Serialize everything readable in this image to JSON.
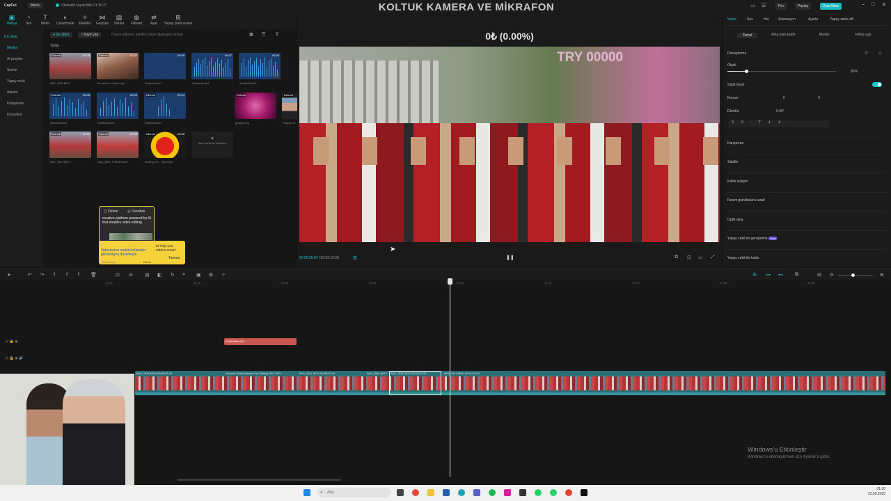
{
  "topbar": {
    "menu": "Menü",
    "autosave": "Otomatik kaydedildi: 01:50:27",
    "overlay_title": "KOLTUK KAMERA VE MİKRAFON",
    "pro": "Pro",
    "paylas": "Paylaş",
    "export": "Dışa Aktar"
  },
  "tooltabs": [
    {
      "label": "Medya",
      "icon": "media-icon"
    },
    {
      "label": "Ses",
      "icon": "audio-icon"
    },
    {
      "label": "Metin",
      "icon": "text-icon"
    },
    {
      "label": "Çıkartmalar",
      "icon": "sticker-icon"
    },
    {
      "label": "Efektler",
      "icon": "effects-icon"
    },
    {
      "label": "Geçişler",
      "icon": "transition-icon"
    },
    {
      "label": "Yazılar",
      "icon": "captions-icon"
    },
    {
      "label": "Filtreler",
      "icon": "filter-icon"
    },
    {
      "label": "Ayar",
      "icon": "adjust-icon"
    },
    {
      "label": "Yapay zekâ avatar",
      "icon": "ai-avatar-icon"
    }
  ],
  "leftside": {
    "active": "İçe aktar",
    "items": [
      "İçe aktar",
      "Medya",
      "AI projeler",
      "Sizinki",
      "Yapay zekâ",
      "Alanlar",
      "Kütüphane",
      "Dreamina"
    ]
  },
  "media": {
    "chip_import": "İçe aktar",
    "chip_record": "Kayıt yap",
    "search_placeholder": "Dosya adlarını, şekilleri veya diyalogları arayın",
    "section": "Tümü",
    "thumbs": [
      {
        "caption": "IMG_7638.MOV",
        "dur": "00:08",
        "tag": "Eklendi"
      },
      {
        "caption": "its what it...ertain.mp4",
        "dur": "00:04",
        "tag": "Eklendi"
      },
      {
        "caption": "Seslendirme1",
        "dur": "00:05",
        "tag": ""
      },
      {
        "caption": "Seslendirme1",
        "dur": "00:07",
        "tag": ""
      },
      {
        "caption": "Seslendirme5",
        "dur": "00:06",
        "tag": ""
      },
      {
        "caption": "Seslendirme4",
        "dur": "00:05",
        "tag": "Eklendi"
      },
      {
        "caption": "Seslendirme3",
        "dur": "00:05",
        "tag": ""
      },
      {
        "caption": "Seslendirme2",
        "dur": "00:04",
        "tag": "Eklendi"
      },
      {
        "caption": "google.png",
        "dur": "",
        "tag": "Eklendi"
      },
      {
        "caption": "Popular Vi...K 2023.mp4",
        "dur": "05:26",
        "tag": "Eklendi"
      },
      {
        "caption": "IMG_7641.MOV",
        "dur": "00:22",
        "tag": "Eklendi"
      },
      {
        "caption": "capy_6B5...F90649.mp4",
        "dur": "00:06",
        "tag": "Eklendi"
      },
      {
        "caption": "Among Us ... Sus.mp4",
        "dur": "00:05",
        "tag": "Eklendi"
      }
    ],
    "ai_tile": "Yapay zekâ ile oluşturun"
  },
  "popup": {
    "delete": "Delete",
    "overdub": "Overdub",
    "body": "creative platform powered by AI that enables video editing.",
    "tip": "Videonuzun metnini düzenler gibi kolayca düzenleyin.",
    "tip_side": "to help you videos smart",
    "skip": "Şimdi değil",
    "demo": "Demo",
    "ok": "Tamam"
  },
  "preview": {
    "price": "0₺ (0.00%)",
    "try_label": "TRY 00000",
    "time_current": "00:00:35:24",
    "time_total": "00:02:16:28"
  },
  "right": {
    "tabs": [
      "Video",
      "Ses",
      "Hız",
      "Animasyon",
      "Ayarla",
      "Yapay zekâ stili"
    ],
    "active_tab": "Video",
    "subtabs": [
      "Temel",
      "Arka plan kaldır",
      "Maske",
      "Rötuş yap"
    ],
    "active_subtab": "Temel",
    "transform": "Dönüştürme",
    "scale": "Ölçek",
    "scale_value": "85%",
    "uniform_scale": "Sabit ölçek",
    "position": "Konum",
    "pos_x": "0",
    "pos_y": "0",
    "rotate": "Döndür",
    "rotate_value": "0.00°",
    "blend": "Karıştırma",
    "stabilize": "Sabitle",
    "quality": "Kalite iyileştir",
    "noise": "Resim gürültüsünü azalt",
    "optical": "Optik akış",
    "ai_expand": "Yapay zekâ ile genişletme",
    "ai_expand_badge": "Free",
    "ai_remove": "Yapay zekâ ile kaldır"
  },
  "timeline": {
    "ticks": [
      "00:00",
      "00:15",
      "00:30",
      "00:45",
      "01:00",
      "01:15",
      "01:30",
      "01:45",
      "02:00",
      "02:15"
    ],
    "text_clip": "FENERBAHÇE",
    "clip_labels": [
      "IMG_7638.MOV 00:00:02:26",
      "Popular Video Memes For Editing NO COPY",
      "IMG_7641.MOV 00:00:03:16",
      "IMG_7641.MOV",
      "IMG_7641.MOV 00:00:07:23",
      "IMG_7641.MOV 00:01:23:12"
    ]
  },
  "watermark": {
    "title": "Windows'u Etkinleştir",
    "sub": "Windows'u etkinleştirmek için Ayarlar'a gidin."
  },
  "taskbar": {
    "search": "Ara",
    "time": "01:30",
    "date": "22.09.2025"
  }
}
